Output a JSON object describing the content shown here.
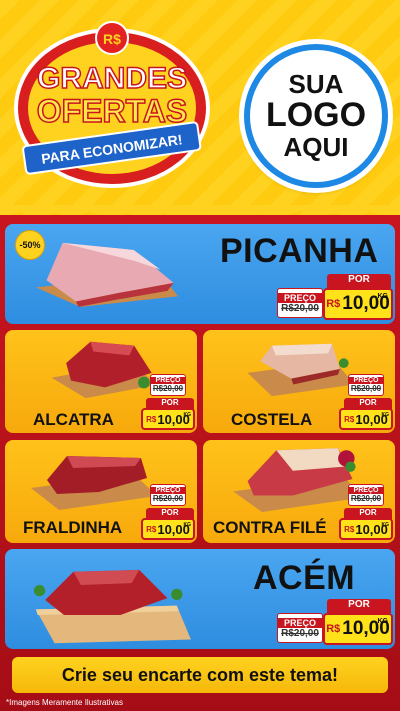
{
  "header": {
    "badge": {
      "currency": "R$",
      "line1": "GRANDES",
      "line2": "OFERTAS",
      "ribbon": "PARA ECONOMIZAR!"
    },
    "logo": {
      "line1": "SUA",
      "line2": "LOGO",
      "line3": "AQUI"
    }
  },
  "products": [
    {
      "name": "PICANHA",
      "discount": "-50%",
      "was_label": "PREÇO",
      "was_price": "R$20,00",
      "now_label": "POR",
      "currency": "R$",
      "price": "10,00",
      "unit": "KG"
    },
    {
      "name": "ALCATRA",
      "was_label": "PREÇO",
      "was_price": "R$20,00",
      "now_label": "POR",
      "currency": "R$",
      "price": "10,00",
      "unit": "KG"
    },
    {
      "name": "COSTELA",
      "was_label": "PREÇO",
      "was_price": "R$20,00",
      "now_label": "POR",
      "currency": "R$",
      "price": "10,00",
      "unit": "KG"
    },
    {
      "name": "FRALDINHA",
      "was_label": "PREÇO",
      "was_price": "R$20,00",
      "now_label": "POR",
      "currency": "R$",
      "price": "10,00",
      "unit": "KG"
    },
    {
      "name": "CONTRA FILÉ",
      "was_label": "PREÇO",
      "was_price": "R$20,00",
      "now_label": "POR",
      "currency": "R$",
      "price": "10,00",
      "unit": "KG"
    },
    {
      "name": "ACÉM",
      "was_label": "PREÇO",
      "was_price": "R$20,00",
      "now_label": "POR",
      "currency": "R$",
      "price": "10,00",
      "unit": "KG"
    }
  ],
  "cta": "Crie seu encarte com este tema!",
  "footnote": "*Imagens Meramente Ilustrativas",
  "colors": {
    "red": "#c8151f",
    "yellow": "#ffd21f",
    "blue": "#2f8de0",
    "orange": "#f7a90c"
  }
}
